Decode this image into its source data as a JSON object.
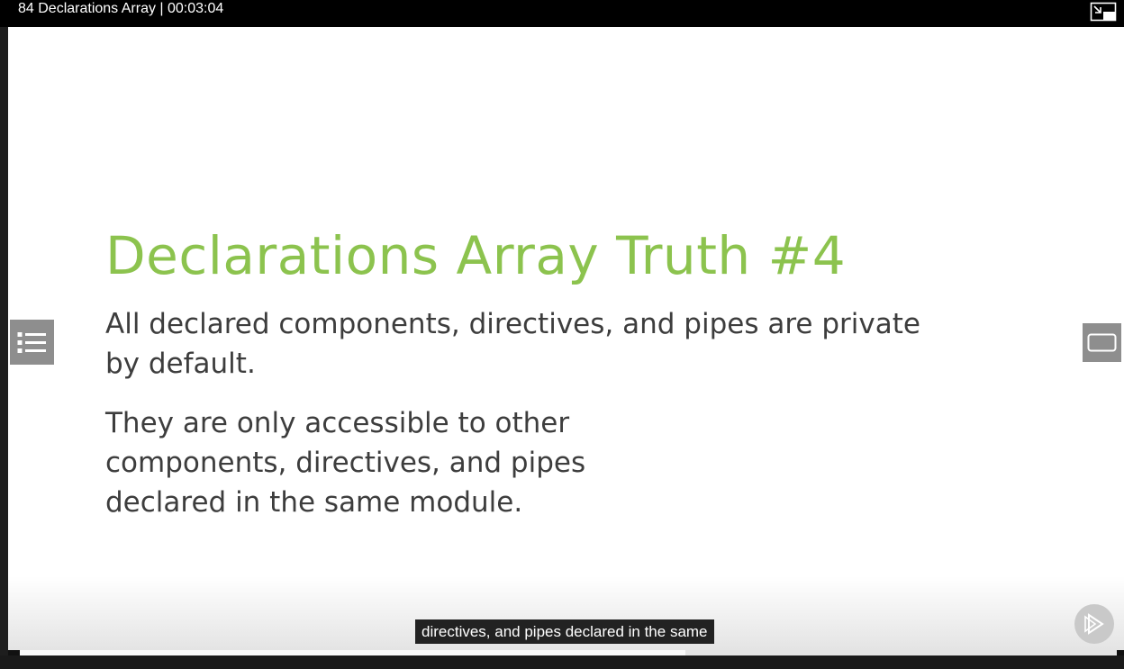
{
  "window": {
    "title": "84 Declarations Array | 00:03:04"
  },
  "slide": {
    "heading": "Declarations Array Truth #4",
    "paragraph_1": "All declared components, directives, and pipes are private by default.",
    "paragraph_2": "They are only accessible to other components, directives, and pipes declared in the same module."
  },
  "captions": {
    "current": "directives, and pipes declared in the same"
  },
  "playback": {
    "progress_fraction": 0.607
  },
  "icons": {
    "exit_fullscreen": "exit-fullscreen-icon",
    "table_of_contents": "list-icon",
    "theater_mode": "theater-mode-icon",
    "play": "play-icon"
  },
  "colors": {
    "heading": "#8cc34e",
    "body_text": "#3d3d3d",
    "side_button": "#8e8e8e",
    "caption_bg": "#222222"
  }
}
